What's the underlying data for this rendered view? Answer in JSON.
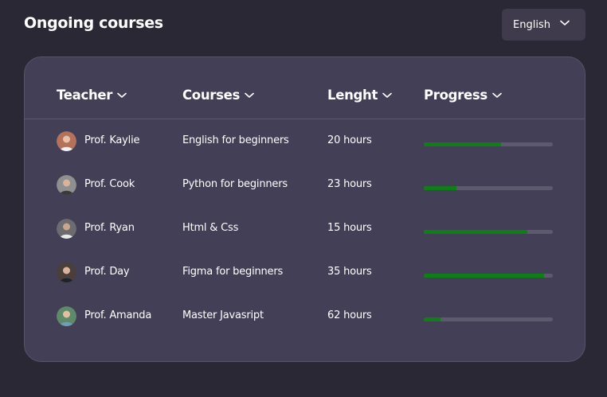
{
  "page": {
    "title": "Ongoing courses"
  },
  "language_select": {
    "value": "English"
  },
  "table": {
    "columns": [
      "Teacher",
      "Courses",
      "Lenght",
      "Progress"
    ],
    "rows": [
      {
        "teacher": "Prof. Kaylie",
        "course": "English for beginners",
        "length": "20 hours",
        "progress": 0.6,
        "avatar_color": "#b5725a"
      },
      {
        "teacher": "Prof. Cook",
        "course": "Python for beginners",
        "length": "23 hours",
        "progress": 0.25,
        "avatar_color": "#8f8f8f"
      },
      {
        "teacher": "Prof. Ryan",
        "course": "Html & Css",
        "length": "15 hours",
        "progress": 0.8,
        "avatar_color": "#6b6b70"
      },
      {
        "teacher": "Prof. Day",
        "course": "Figma for beginners",
        "length": "35 hours",
        "progress": 0.93,
        "avatar_color": "#4a3f3a"
      },
      {
        "teacher": "Prof. Amanda",
        "course": "Master Javasript",
        "length": "62 hours",
        "progress": 0.13,
        "avatar_color": "#5d8a6a"
      }
    ]
  },
  "colors": {
    "progress": "#0f7e17",
    "track": "#5e5a6d"
  },
  "icons": {
    "sort": "chevron-down-icon",
    "select": "chevron-down-icon",
    "avatar": "avatar"
  }
}
